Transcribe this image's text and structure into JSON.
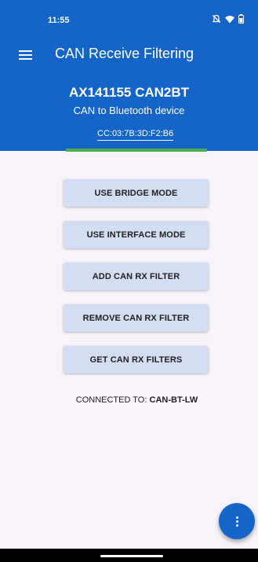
{
  "status_bar": {
    "time": "11:55",
    "icons": [
      "mute-icon",
      "wifi-icon",
      "battery-icon"
    ]
  },
  "app_bar": {
    "title": "CAN Receive Filtering",
    "menu_icon": "hamburger-menu-icon"
  },
  "device": {
    "name": "AX141155 CAN2BT",
    "description": "CAN to Bluetooth device",
    "mac": "CC:03:7B:3D:F2:B6"
  },
  "buttons": {
    "bridge": "USE BRIDGE MODE",
    "interface": "USE INTERFACE MODE",
    "add_filter": "ADD CAN RX FILTER",
    "remove_filter": "REMOVE CAN RX FILTER",
    "get_filters": "GET CAN RX FILTERS"
  },
  "connection": {
    "label": "CONNECTED TO:",
    "device": "CAN-BT-LW"
  },
  "fab": {
    "icon": "more-vert-icon"
  },
  "colors": {
    "primary": "#1565c9",
    "progress": "#4caf50",
    "button_bg": "#d3def2",
    "background": "#f7f5fb"
  }
}
